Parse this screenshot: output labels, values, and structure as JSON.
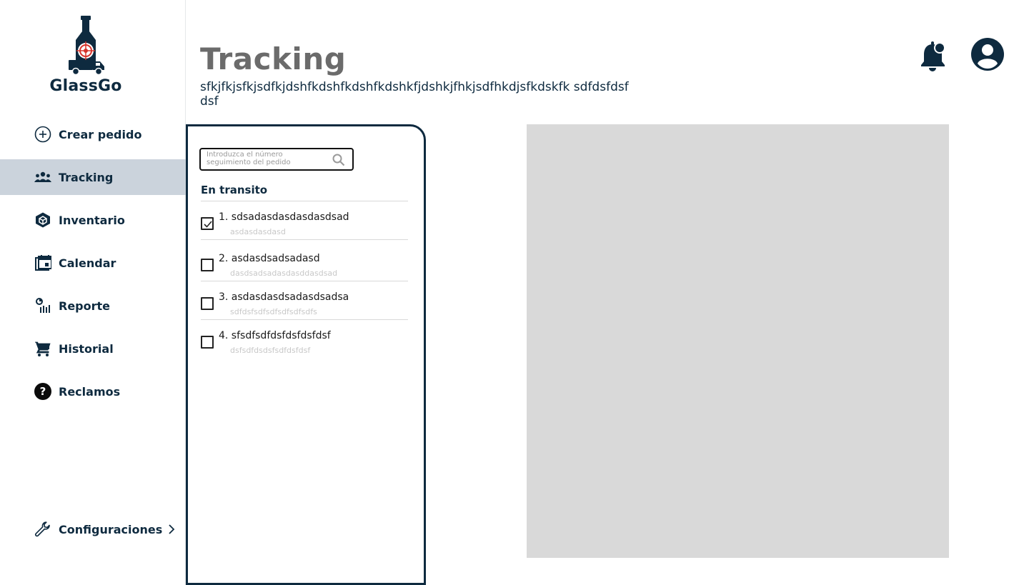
{
  "app": {
    "brand": "GlassGo"
  },
  "sidebar": {
    "items": [
      {
        "label": "Crear pedido",
        "icon": "plus-circle-icon"
      },
      {
        "label": "Tracking",
        "icon": "people-group-icon",
        "active": true
      },
      {
        "label": "Inventario",
        "icon": "cube-icon"
      },
      {
        "label": "Calendar",
        "icon": "calendar-icon"
      },
      {
        "label": "Reporte",
        "icon": "report-chart-icon"
      },
      {
        "label": "Historial",
        "icon": "cart-icon"
      },
      {
        "label": "Reclamos",
        "icon": "question-circle-icon"
      }
    ],
    "settings": {
      "label": "Configuraciones",
      "icon": "wrench-icon"
    }
  },
  "header": {
    "title": "Tracking",
    "subtitle": "sfkjfkjsfkjsdfkjdshfkdshfkdshfkdshkfjdshkjfhkjsdfhkdjsfkdskfk sdfdsfdsfdsf"
  },
  "panel": {
    "search": {
      "placeholder": "Introduzca el número seguimiento del pedido"
    },
    "section_title": "En transito",
    "orders": [
      {
        "title": "1. sdsadasdasdasdasdsad",
        "sub": "asdasdasdasd",
        "checked": true
      },
      {
        "title": "2. asdasdsadsadasd",
        "sub": "dasdsadsadasdasddasdsad",
        "checked": false
      },
      {
        "title": "3. asdasdasdsadasdsadsa",
        "sub": "sdfdsfsdfsdfsdfsdfsdfs",
        "checked": false
      },
      {
        "title": "4. sfsdfsdfdsfdsfdsfdsf",
        "sub": "dsfsdfdsdsfsdfdsfdsf",
        "checked": false
      }
    ]
  },
  "colors": {
    "navy": "#0e2a3f",
    "active_bg": "#cbd3dc",
    "map_placeholder": "#d9d9d9",
    "title_gray": "#6b6b6b",
    "logo_red": "#d6332b"
  }
}
